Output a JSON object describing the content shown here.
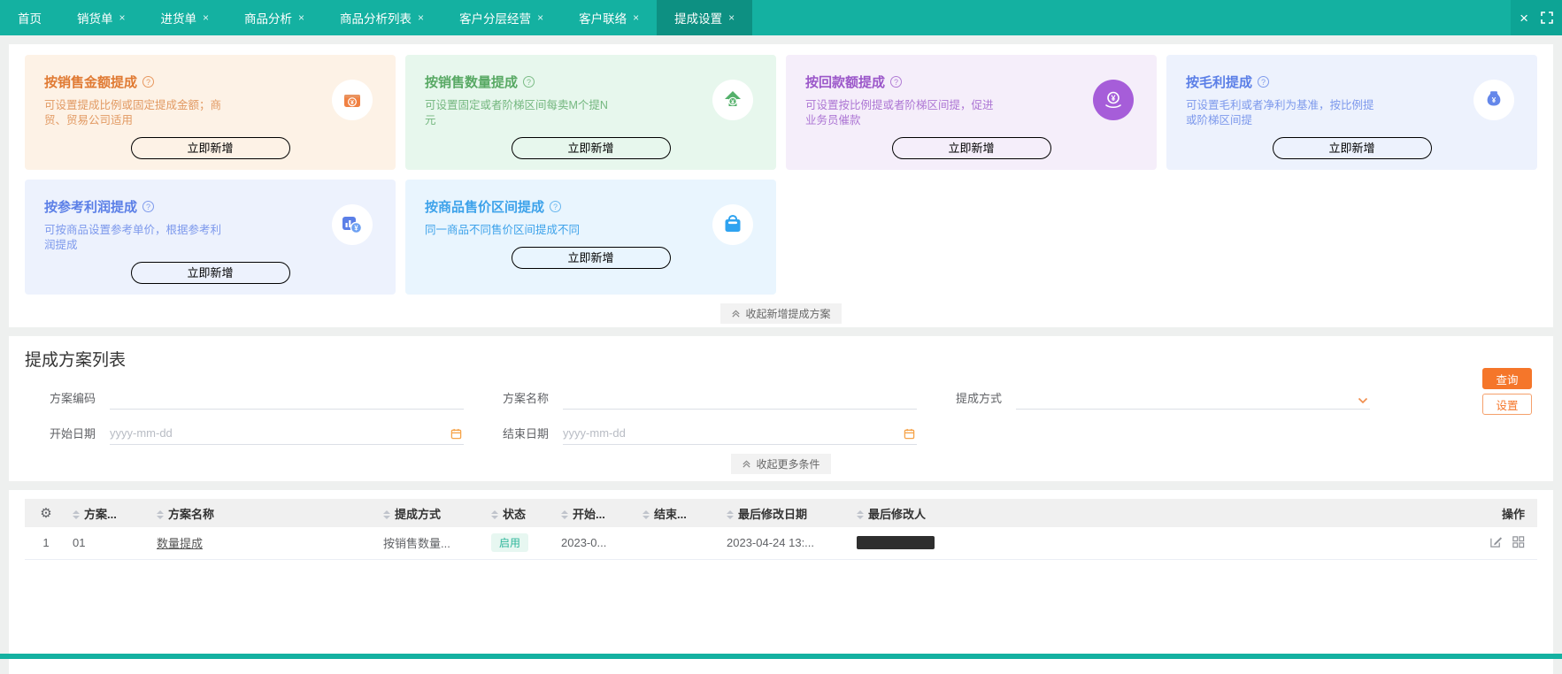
{
  "topbar": {
    "close_glyph": "×",
    "tabs": [
      {
        "label": "首页"
      },
      {
        "label": "销货单"
      },
      {
        "label": "进货单"
      },
      {
        "label": "商品分析"
      },
      {
        "label": "商品分析列表"
      },
      {
        "label": "客户分层经营"
      },
      {
        "label": "客户联络"
      },
      {
        "label": "提成设置"
      }
    ],
    "close_all": "×"
  },
  "help_glyph": "?",
  "cards": [
    {
      "title": "按销售金额提成",
      "desc": "可设置提成比例或固定提成金额；商贸、贸易公司适用",
      "button": "立即新增",
      "icon": "money-chest-icon"
    },
    {
      "title": "按销售数量提成",
      "desc": "可设置固定或者阶梯区间每卖M个提N元",
      "button": "立即新增",
      "icon": "arrow-up-yuan-icon"
    },
    {
      "title": "按回款额提成",
      "desc": "可设置按比例提或者阶梯区间提，促进业务员催款",
      "button": "立即新增",
      "icon": "payment-received-icon"
    },
    {
      "title": "按毛利提成",
      "desc": "可设置毛利或者净利为基准，按比例提或阶梯区间提",
      "button": "立即新增",
      "icon": "money-bag-icon"
    },
    {
      "title": "按参考利润提成",
      "desc": "可按商品设置参考单价，根据参考利 润提成",
      "button": "立即新增",
      "icon": "chart-coin-icon"
    },
    {
      "title": "按商品售价区间提成",
      "desc": "同一商品不同售价区间提成不同",
      "button": "立即新增",
      "icon": "shopping-bag-icon"
    }
  ],
  "collapse_cards_label": "收起新增提成方案",
  "list_section": {
    "title": "提成方案列表",
    "filters": {
      "code_label": "方案编码",
      "name_label": "方案名称",
      "type_label": "提成方式",
      "start_label": "开始日期",
      "end_label": "结束日期",
      "date_placeholder": "yyyy-mm-dd",
      "search_button": "查询",
      "settings_button": "设置",
      "collapse_label": "收起更多条件"
    }
  },
  "table": {
    "headers": {
      "code": "方案...",
      "name": "方案名称",
      "type": "提成方式",
      "status": "状态",
      "start": "开始...",
      "end": "结束...",
      "modified_date": "最后修改日期",
      "modified_by": "最后修改人",
      "actions": "操作"
    },
    "rows": [
      {
        "index": "1",
        "code": "01",
        "name": "数量提成",
        "type": "按销售数量...",
        "status": "启用",
        "start": "2023-0...",
        "end": "",
        "modified_date": "2023-04-24 13:...",
        "modified_by_redacted": true
      }
    ]
  },
  "colors": {
    "topbar_teal": "#14b1a1",
    "active_tab_teal": "#0d9082",
    "accent_orange": "#f5762a",
    "card_orange": "#e07a33",
    "card_green": "#58a964",
    "card_purple": "#9b57c9",
    "card_blue": "#5b7fe7",
    "card_lightblue": "#3da2ea",
    "status_badge_text": "#2eb69a",
    "status_badge_bg": "#e7f7f1"
  }
}
